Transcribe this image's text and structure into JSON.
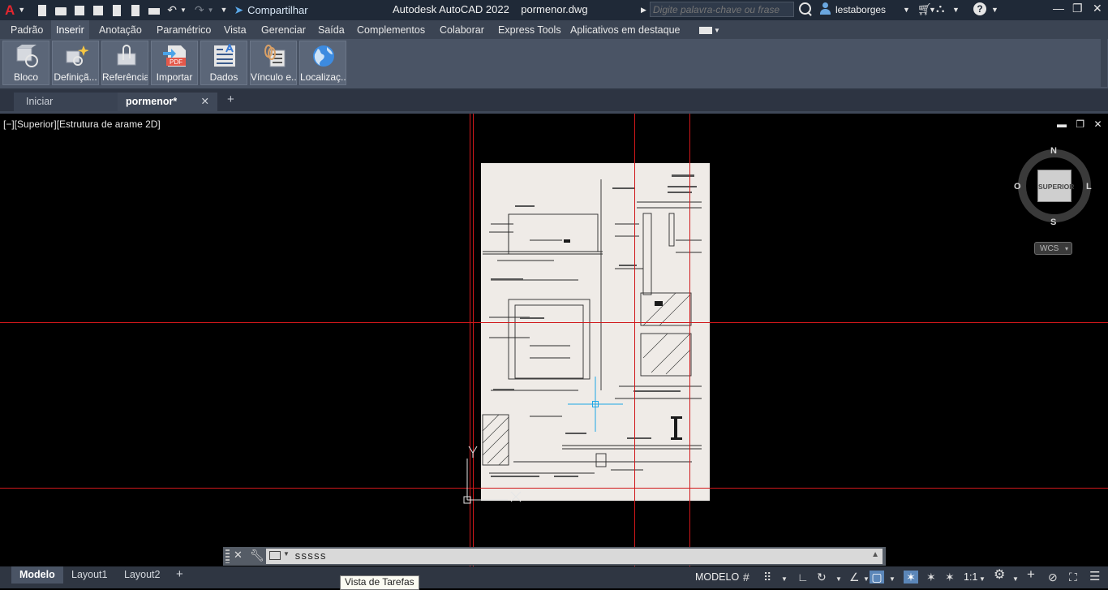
{
  "titlebar": {
    "app_title": "Autodesk AutoCAD 2022    pormenor.dwg",
    "share_label": "Compartilhar",
    "search_placeholder": "Digite palavra-chave ou frase",
    "user_name": "lestaborges",
    "brand_letter": "A"
  },
  "ribbon": {
    "tabs": [
      "Padrão",
      "Inserir",
      "Anotação",
      "Paramétrico",
      "Vista",
      "Gerenciar",
      "Saída",
      "Complementos",
      "Colaborar",
      "Express Tools",
      "Aplicativos em destaque"
    ],
    "active_tab": "Inserir",
    "buttons": [
      {
        "label": "Bloco",
        "icon": "block-icon"
      },
      {
        "label": "Definiçã...",
        "icon": "block-definition-icon"
      },
      {
        "label": "Referência",
        "icon": "reference-icon"
      },
      {
        "label": "Importar",
        "icon": "pdf-import-icon"
      },
      {
        "label": "Dados",
        "icon": "data-icon"
      },
      {
        "label": "Vínculo e...",
        "icon": "link-extract-icon"
      },
      {
        "label": "Localizaç...",
        "icon": "globe-icon"
      }
    ],
    "pdf_text": "PDF"
  },
  "filetabs": {
    "start": "Iniciar",
    "drawing": "pormenor*"
  },
  "viewport": {
    "label": "[−][Superior][Estrutura de arame 2D]",
    "compass": {
      "north": "N",
      "south": "S",
      "east": "L",
      "west": "O",
      "top_face": "SUPERIOR"
    },
    "wcs": "WCS"
  },
  "cmdline": {
    "text": "sssss"
  },
  "statusbar": {
    "layout_tabs": [
      "Modelo",
      "Layout1",
      "Layout2"
    ],
    "model_label": "MODELO",
    "scale": "1:1"
  },
  "tooltip": "Vista de Tarefas",
  "colors": {
    "titlebar": "#1f2937",
    "ribbon": "#4a5465",
    "crosshair": "#e01b1b",
    "cursor": "#1ea7e6"
  }
}
